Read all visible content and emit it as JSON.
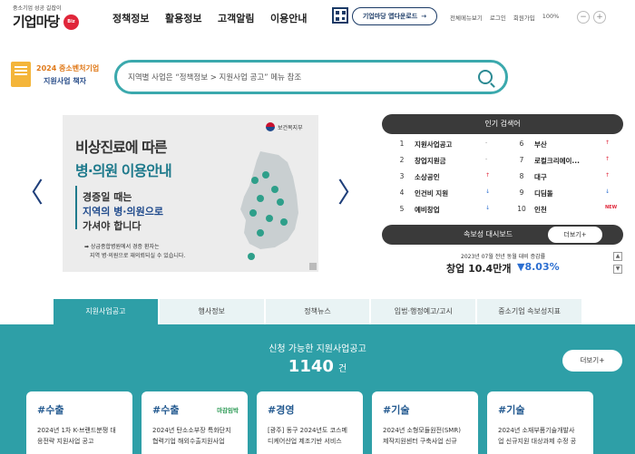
{
  "header": {
    "logo_tagline": "중소기업 성공 길잡이",
    "logo_name": "기업마당",
    "logo_badge": "Biz info",
    "gnb": [
      "정책정보",
      "활용정보",
      "고객알림",
      "이용안내"
    ],
    "app_download": "기업마당 앱다운로드",
    "app_arrow": "→",
    "util": [
      "전체메뉴보기",
      "로그인",
      "회원가입",
      "100%"
    ],
    "zoom_out": "−",
    "zoom_in": "+"
  },
  "promo": {
    "line1": "2024 중소벤처기업",
    "line2": "지원사업 책자"
  },
  "search": {
    "placeholder": "지역별 사업은 “정책정보 > 지원사업 공고” 메뉴 참조"
  },
  "slide": {
    "ministry": "보건복지부",
    "heading1": "비상진료에 따른",
    "heading2": "병·의원 이용안내",
    "body1": "경증일 때는",
    "body2": "지역의 병·의원으로",
    "body3": "가셔야 합니다",
    "note1": "➡ 상급종합병원에서 경증 환자는",
    "note2": "지역 병·의원으로 재의뢰되실 수 있습니다.",
    "prev": "〈",
    "next": "〉"
  },
  "popular": {
    "title": "인기 검색어",
    "items": [
      {
        "num": "1",
        "word": "지원사업공고",
        "trend": "-",
        "dir": "same"
      },
      {
        "num": "2",
        "word": "창업지원금",
        "trend": "-",
        "dir": "same"
      },
      {
        "num": "3",
        "word": "소상공인",
        "trend": "↑",
        "dir": "up"
      },
      {
        "num": "4",
        "word": "인건비 지원",
        "trend": "↓",
        "dir": "down"
      },
      {
        "num": "5",
        "word": "예비창업",
        "trend": "↓",
        "dir": "down"
      },
      {
        "num": "6",
        "word": "부산",
        "trend": "↑",
        "dir": "up"
      },
      {
        "num": "7",
        "word": "로컬크리에이...",
        "trend": "↑",
        "dir": "up"
      },
      {
        "num": "8",
        "word": "대구",
        "trend": "↑",
        "dir": "up"
      },
      {
        "num": "9",
        "word": "디딤돌",
        "trend": "↓",
        "dir": "down"
      },
      {
        "num": "10",
        "word": "인천",
        "trend": "NEW",
        "dir": "new"
      }
    ]
  },
  "flash": {
    "title": "속보성 대시보드",
    "more": "더보기+",
    "date": "2023년 07월 전년 동월 대비 증감률",
    "value": "창업 10.4만개",
    "pct": "▼8.03%",
    "up": "▲",
    "down": "▼"
  },
  "tabs": [
    "지원사업공고",
    "행사정보",
    "정책뉴스",
    "입법·행정예고/고시",
    "중소기업 속보성지표"
  ],
  "list": {
    "title": "신청 가능한 지원사업공고",
    "count": "1140",
    "unit": "건",
    "more": "더보기+",
    "cards": [
      {
        "tag": "#수출",
        "badge": "",
        "l1": "2024년 1차 K-브랜드분쟁 대",
        "l2": "응전략 지원사업 공고"
      },
      {
        "tag": "#수출",
        "badge": "마감임박",
        "l1": "2024년 탄소소부장 특화단지",
        "l2": "협력기업 해외수출지원사업"
      },
      {
        "tag": "#경영",
        "badge": "",
        "l1": "[광주] 동구 2024년도 코스메",
        "l2": "디케어산업 제조기반 서비스"
      },
      {
        "tag": "#기술",
        "badge": "",
        "l1": "2024년 소형모듈원전(SMR)",
        "l2": "제작지원센터 구축사업 신규"
      },
      {
        "tag": "#기술",
        "badge": "",
        "l1": "2024년 소재부품기술개발사",
        "l2": "업 신규지원 대상과제 수정 공"
      }
    ]
  }
}
